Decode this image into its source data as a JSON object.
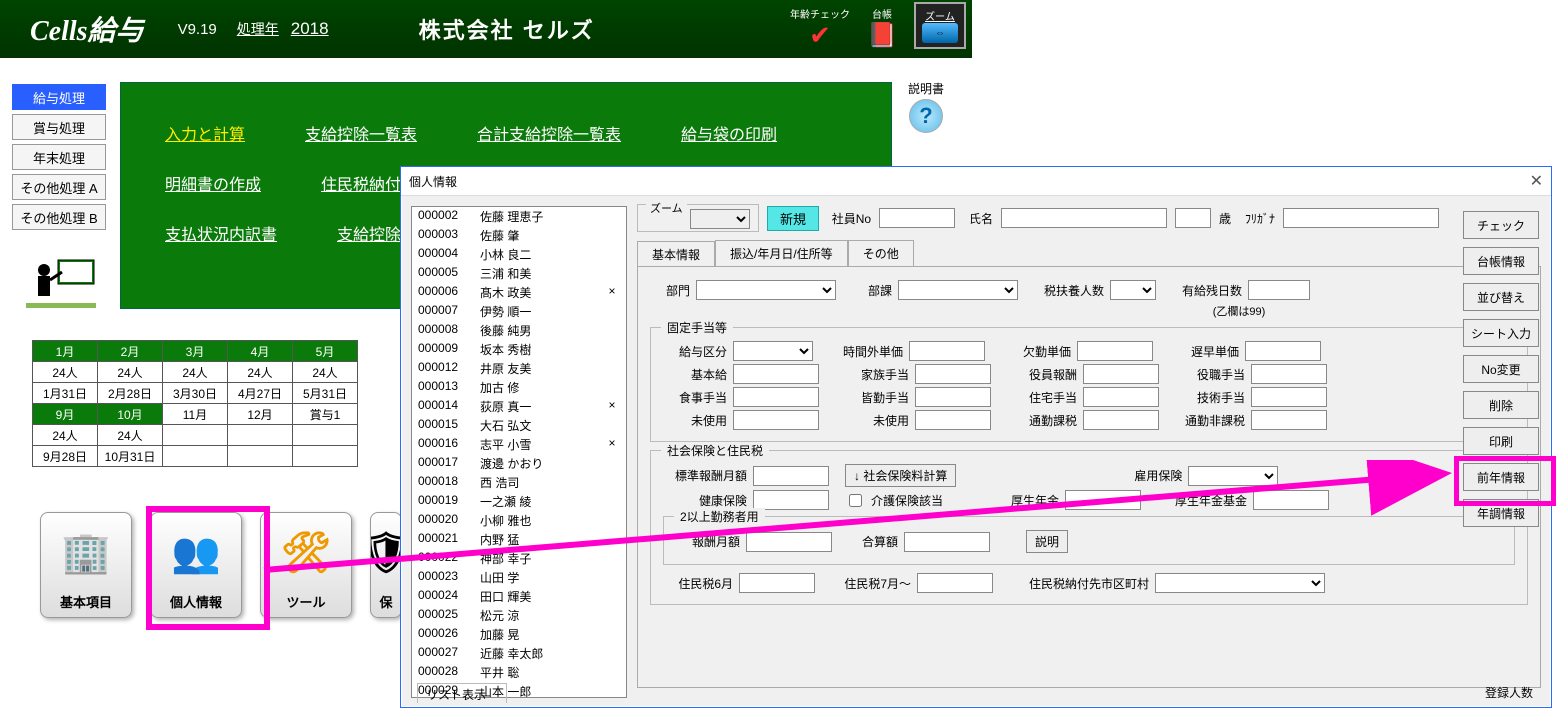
{
  "header": {
    "title": "Cells給与",
    "version": "V9.19",
    "year_label": "処理年",
    "year": "2018",
    "company": "株式会社 セルズ",
    "icon_age": "年齢チェック",
    "icon_book": "台帳",
    "icon_zoom": "ズーム"
  },
  "sidebuttons": [
    "給与処理",
    "賞与処理",
    "年末処理",
    "その他処理 A",
    "その他処理 B"
  ],
  "mainmenu": {
    "r1": [
      "入力と計算",
      "支給控除一覧表",
      "合計支給控除一覧表",
      "給与袋の印刷"
    ],
    "r2": [
      "明細書の作成",
      "住民税納付",
      "",
      ""
    ],
    "r3": [
      "支払状況内訳書",
      "支給控除チ",
      "",
      ""
    ]
  },
  "help_label": "説明書",
  "calendar": {
    "row1": [
      "1月",
      "2月",
      "3月",
      "4月",
      "5月"
    ],
    "row2": [
      "24人",
      "24人",
      "24人",
      "24人",
      "24人"
    ],
    "row3": [
      "1月31日",
      "2月28日",
      "3月30日",
      "4月27日",
      "5月31日"
    ],
    "row4": [
      "9月",
      "10月",
      "11月",
      "12月",
      "賞与1"
    ],
    "row5": [
      "24人",
      "24人",
      "",
      "",
      ""
    ],
    "row6": [
      "9月28日",
      "10月31日",
      "",
      "",
      ""
    ]
  },
  "bigicons": [
    "基本項目",
    "個人情報",
    "ツール",
    "保"
  ],
  "win": {
    "title": "個人情報",
    "zoom_legend": "ズーム",
    "new_btn": "新規",
    "emp_no_label": "社員No",
    "name_label": "氏名",
    "age_label": "歳",
    "kana_label": "ﾌﾘｶﾞﾅ",
    "tabs": [
      "基本情報",
      "振込/年月日/住所等",
      "その他"
    ],
    "dept_label": "部門",
    "sect_label": "部課",
    "dep_label": "税扶養人数",
    "dep_note": "(乙欄は99)",
    "paid_label": "有給残日数",
    "fixed_allow_title": "固定手当等",
    "fa_labels": {
      "pay_class": "給与区分",
      "ot_rate": "時間外単価",
      "absent_rate": "欠勤単価",
      "late_rate": "遅早単価",
      "base": "基本給",
      "family": "家族手当",
      "officer": "役員報酬",
      "post": "役職手当",
      "meal": "食事手当",
      "attend": "皆勤手当",
      "house": "住宅手当",
      "skill": "技術手当",
      "unused1": "未使用",
      "unused2": "未使用",
      "commute_tax": "通勤課税",
      "commute_notax": "通勤非課税"
    },
    "ins_title": "社会保険と住民税",
    "ins": {
      "std_monthly": "標準報酬月額",
      "calc_btn": "↓ 社会保険料計算",
      "emp_ins": "雇用保険",
      "health": "健康保険",
      "care_chk": "介護保険該当",
      "welfare": "厚生年金",
      "welfare_fund": "厚生年金基金"
    },
    "dual_title": "2以上勤務者用",
    "dual": {
      "monthly": "報酬月額",
      "total": "合算額",
      "explain": "説明"
    },
    "res": {
      "june": "住民税6月",
      "july": "住民税7月～",
      "city": "住民税納付先市区町村"
    },
    "sidebtns": [
      "チェック",
      "台帳情報",
      "並び替え",
      "シート入力",
      "No変更",
      "削除",
      "印刷",
      "前年情報",
      "年調情報"
    ],
    "reg_label": "登録人数",
    "list_title": "リスト表示"
  },
  "employees": [
    {
      "id": "000002",
      "name": "佐藤 理恵子",
      "x": ""
    },
    {
      "id": "000003",
      "name": "佐藤 肇",
      "x": ""
    },
    {
      "id": "000004",
      "name": "小林 良二",
      "x": ""
    },
    {
      "id": "000005",
      "name": "三浦 和美",
      "x": ""
    },
    {
      "id": "000006",
      "name": "髙木 政美",
      "x": "×"
    },
    {
      "id": "000007",
      "name": "伊勢 順一",
      "x": ""
    },
    {
      "id": "000008",
      "name": "後藤 純男",
      "x": ""
    },
    {
      "id": "000009",
      "name": "坂本 秀樹",
      "x": ""
    },
    {
      "id": "000012",
      "name": "井原 友美",
      "x": ""
    },
    {
      "id": "000013",
      "name": "加古 修",
      "x": ""
    },
    {
      "id": "000014",
      "name": "荻原 真一",
      "x": "×"
    },
    {
      "id": "000015",
      "name": "大石 弘文",
      "x": ""
    },
    {
      "id": "000016",
      "name": "志平 小雪",
      "x": "×"
    },
    {
      "id": "000017",
      "name": "渡邊 かおり",
      "x": ""
    },
    {
      "id": "000018",
      "name": "西 浩司",
      "x": ""
    },
    {
      "id": "000019",
      "name": "一之瀬 綾",
      "x": ""
    },
    {
      "id": "000020",
      "name": "小柳 雅也",
      "x": ""
    },
    {
      "id": "000021",
      "name": "内野 猛",
      "x": ""
    },
    {
      "id": "000022",
      "name": "神部 幸子",
      "x": ""
    },
    {
      "id": "000023",
      "name": "山田 学",
      "x": ""
    },
    {
      "id": "000024",
      "name": "田口 輝美",
      "x": ""
    },
    {
      "id": "000025",
      "name": "松元 涼",
      "x": ""
    },
    {
      "id": "000026",
      "name": "加藤 晃",
      "x": ""
    },
    {
      "id": "000027",
      "name": "近藤 幸太郎",
      "x": ""
    },
    {
      "id": "000028",
      "name": "平井 聡",
      "x": ""
    },
    {
      "id": "000029",
      "name": "山本 一郎",
      "x": ""
    }
  ]
}
